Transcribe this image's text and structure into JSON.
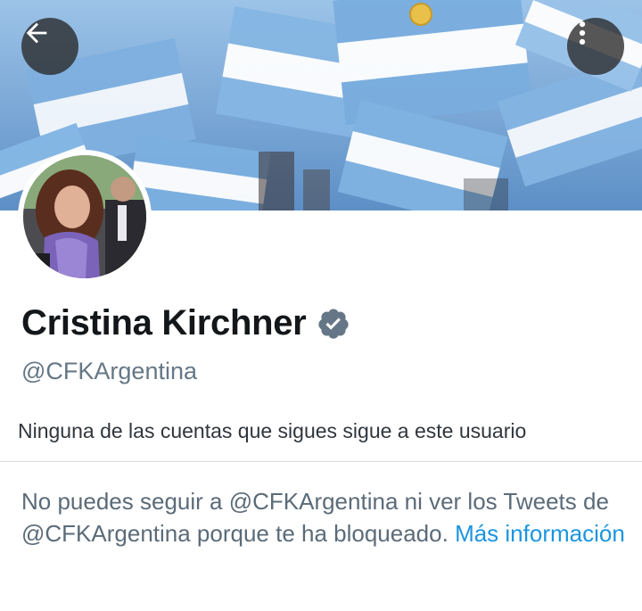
{
  "header": {
    "back_icon": "arrow-left-icon",
    "more_icon": "more-vertical-icon"
  },
  "profile": {
    "display_name": "Cristina Kirchner",
    "verified_icon": "verified-badge-icon",
    "handle": "@CFKArgentina",
    "followers_note": "Ninguna de las cuentas que sigues sigue a este usuario"
  },
  "blocked": {
    "message_part1": "No puedes seguir a @CFKArgentina ni ver los Tweets de @CFKArgentina porque te ha bloqueado. ",
    "link_label": "Más información"
  },
  "colors": {
    "link": "#1b95e0",
    "name": "#14171a",
    "muted": "#657786",
    "verified": "#657786"
  }
}
